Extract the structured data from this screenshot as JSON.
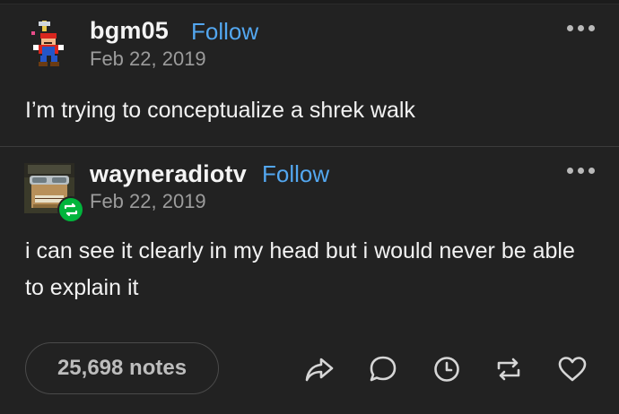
{
  "posts": [
    {
      "username": "bgm05",
      "follow_label": "Follow",
      "date": "Feb 22, 2019",
      "text": "I’m trying to conceptualize a shrek walk",
      "avatar_icon": "mario-sprite-avatar"
    },
    {
      "username": "wayneradiotv",
      "follow_label": "Follow",
      "date": "Feb 22, 2019",
      "text": "i can see it clearly in my head but i would never be able to explain it",
      "avatar_icon": "goggles-face-avatar",
      "badge_icon": "reblog-icon"
    }
  ],
  "footer": {
    "notes_label": "25,698 notes",
    "actions": [
      "share-icon",
      "reply-icon",
      "queue-clock-icon",
      "reblog-icon",
      "like-heart-icon"
    ]
  },
  "colors": {
    "background": "#222222",
    "accent": "#53a7f0",
    "reblog_badge": "#00b53c",
    "muted": "#9c9c9c"
  }
}
